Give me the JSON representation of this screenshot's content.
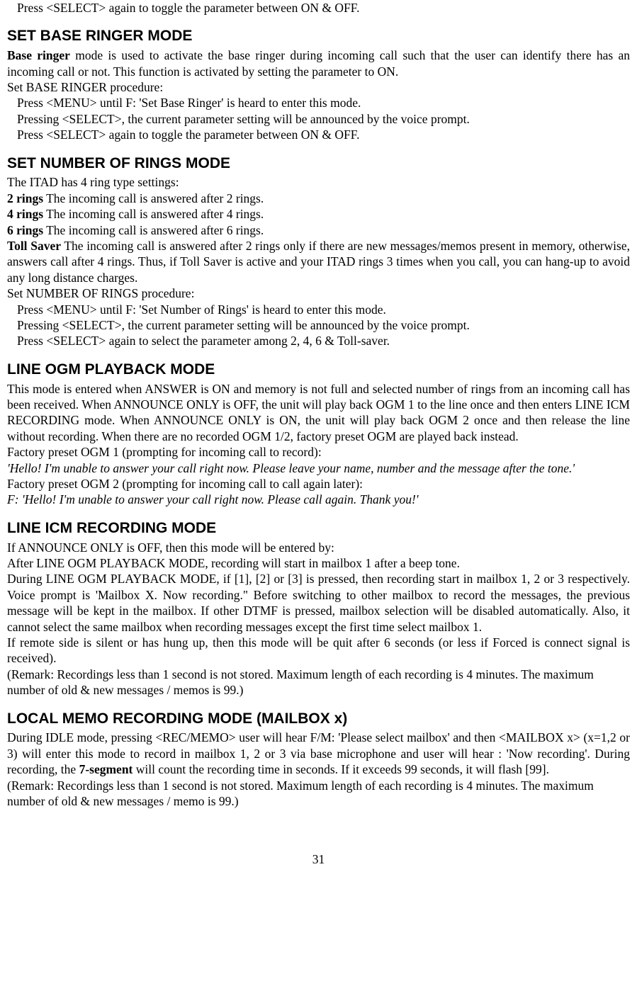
{
  "intro_line": "Press <SELECT> again to toggle the parameter between ON & OFF.",
  "sections": {
    "baseRinger": {
      "title": "SET BASE RINGER MODE",
      "intro_bold": "Base ringer",
      "intro_rest": " mode is used to activate the base ringer during incoming call such that the user can identify there has an incoming call or not. This function is activated by setting the parameter to ON.",
      "procTitle": "Set BASE RINGER procedure:",
      "steps": [
        "Press <MENU> until F: 'Set Base Ringer' is heard to enter this mode.",
        "Pressing <SELECT>, the current parameter setting will be announced by the voice prompt.",
        "Press <SELECT> again to toggle the parameter between ON & OFF."
      ]
    },
    "numRings": {
      "title": "SET NUMBER OF RINGS MODE",
      "intro": "The ITAD has 4 ring type settings:",
      "r2_bold": "2 rings",
      "r2_rest": " The incoming call is answered after 2 rings.",
      "r4_bold": "4 rings",
      "r4_rest": " The incoming call is answered after 4 rings.",
      "r6_bold": "6 rings",
      "r6_rest": " The incoming call is answered after 6 rings.",
      "ts_bold": "Toll Saver",
      "ts_rest": " The incoming call is answered after 2 rings only if there are new messages/memos present in memory, otherwise, answers call after 4 rings. Thus, if Toll Saver is active and your ITAD rings 3 times when you call, you can hang-up to avoid any long distance charges.",
      "procTitle": "Set NUMBER OF RINGS procedure:",
      "steps": [
        "Press <MENU> until F: 'Set Number of Rings' is heard to enter this mode.",
        "Pressing <SELECT>, the current parameter setting will be announced by the voice prompt.",
        "Press <SELECT> again to select the parameter among 2, 4, 6 & Toll-saver."
      ]
    },
    "ogmPlayback": {
      "title": "LINE OGM PLAYBACK MODE",
      "p1": "This mode is entered when ANSWER is ON and memory is not full and selected number of rings from an incoming call has been received. When ANNOUNCE ONLY is OFF, the unit will play back OGM 1 to the  line once and then enters LINE ICM RECORDING mode. When ANNOUNCE ONLY is ON, the unit will play back OGM 2 once and then release the line without recording. When there are no recorded OGM 1/2, factory preset OGM are played back instead.",
      "ogm1_label": "Factory preset OGM 1 (prompting for incoming call to record):",
      "ogm1_msg": "'Hello! I'm unable to answer your call right now. Please leave your name, number and the message after the tone.'",
      "ogm2_label": "Factory preset OGM 2 (prompting for incoming call to call again later):",
      "ogm2_msg": "F: 'Hello! I'm unable to answer your call right now. Please call again. Thank you!'"
    },
    "icmRecording": {
      "title": "LINE ICM RECORDING MODE",
      "p1": "If ANNOUNCE ONLY is OFF, then this mode will be entered by:",
      "p2": "After LINE OGM PLAYBACK MODE, recording will start in mailbox 1 after a beep tone.",
      "p3": "During LINE OGM PLAYBACK MODE, if [1], [2] or [3] is pressed, then recording start in mailbox 1, 2 or 3 respectively. Voice prompt is 'Mailbox X. Now recording.\" Before switching to other mailbox to record the messages, the previous message will be kept in the mailbox. If other DTMF is pressed, mailbox selection will be disabled automatically. Also, it cannot select the same mailbox when recording messages except the first time select mailbox 1.",
      "p4": "If remote side is silent or has hung up, then this mode will be quit after 6 seconds (or less if Forced is connect signal is received).",
      "p5": "(Remark: Recordings less than 1 second is not stored. Maximum length of each recording is 4 minutes. The maximum number of old & new messages / memos is 99.)"
    },
    "localMemo": {
      "title": "LOCAL MEMO RECORDING MODE (MAILBOX x)",
      "p1_a": "During IDLE mode, pressing <REC/MEMO> user will hear F/M: 'Please select mailbox' and then <MAILBOX x> (x=1,2 or 3) will enter this mode to record in mailbox 1, 2 or 3 via base microphone and user will hear : 'Now recording'. During recording, the ",
      "p1_bold": "7-segment",
      "p1_b": " will count the recording time in seconds. If it exceeds 99 seconds, it will flash [99].",
      "p2": "(Remark: Recordings less than 1 second is not stored. Maximum length of each recording is 4 minutes. The maximum number of old & new messages / memo is 99.)"
    }
  },
  "pageNumber": "31"
}
